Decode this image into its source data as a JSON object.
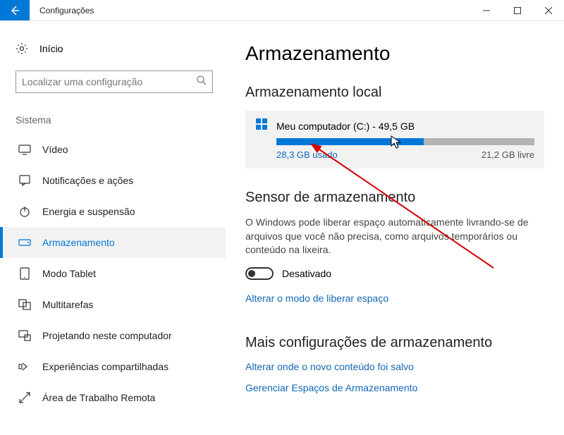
{
  "window": {
    "title": "Configurações"
  },
  "sidebar": {
    "home_label": "Início",
    "search_placeholder": "Localizar uma configuração",
    "category": "Sistema",
    "items": [
      {
        "label": "Vídeo"
      },
      {
        "label": "Notificações e ações"
      },
      {
        "label": "Energia e suspensão"
      },
      {
        "label": "Armazenamento"
      },
      {
        "label": "Modo Tablet"
      },
      {
        "label": "Multitarefas"
      },
      {
        "label": "Projetando neste computador"
      },
      {
        "label": "Experiências compartilhadas"
      },
      {
        "label": "Área de Trabalho Remota"
      }
    ]
  },
  "page": {
    "title": "Armazenamento",
    "local_title": "Armazenamento local",
    "drive": {
      "name": "Meu computador (C:) - 49,5 GB",
      "used": "28,3 GB usado",
      "free": "21,2 GB livre",
      "used_pct": 57
    },
    "sensor": {
      "title": "Sensor de armazenamento",
      "desc": "O Windows pode liberar espaço automaticamente livrando-se de arquivos que você não precisa, como arquivos temporários ou conteúdo na lixeira.",
      "toggle_state": "Desativado",
      "link": "Alterar o modo de liberar espaço"
    },
    "more": {
      "title": "Mais configurações de armazenamento",
      "link1": "Alterar onde o novo conteúdo foi salvo",
      "link2": "Gerenciar Espaços de Armazenamento"
    }
  }
}
